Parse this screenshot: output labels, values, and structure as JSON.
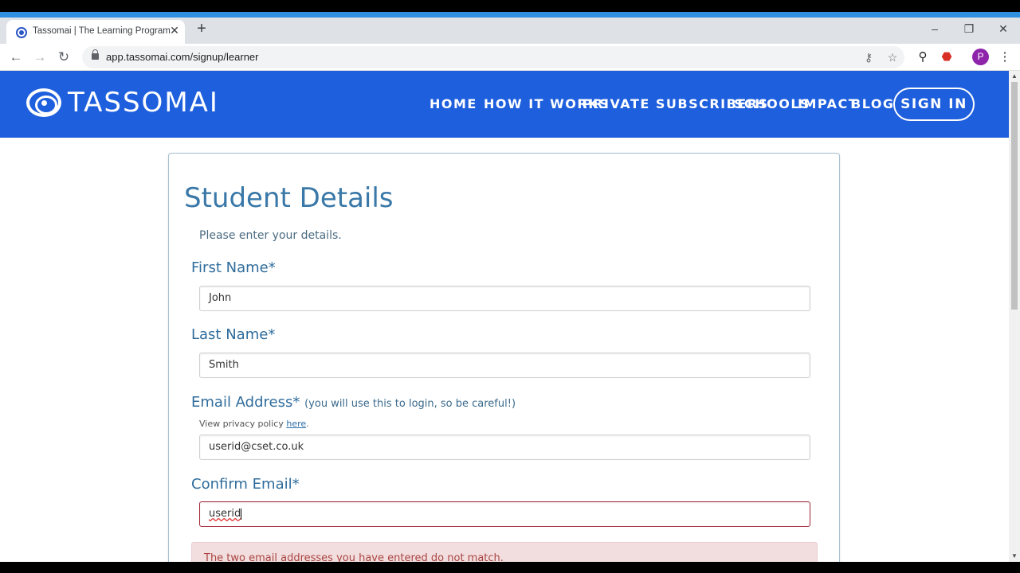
{
  "browser": {
    "tab_title": "Tassomai | The Learning Program",
    "tab_close": "✕",
    "new_tab": "+",
    "url": "app.tassomai.com/signup/learner",
    "profile_initial": "P",
    "window_controls": {
      "minimize": "–",
      "restore": "❐",
      "close": "✕"
    }
  },
  "site": {
    "brand": "TASSOMAI",
    "nav": [
      "HOME",
      "HOW IT WORKS",
      "PRIVATE SUBSCRIBERS",
      "SCHOOLS",
      "IMPACT",
      "BLOG"
    ],
    "sign_in": "SIGN IN",
    "brand_color": "#1e5fdd"
  },
  "form": {
    "title": "Student Details",
    "intro": "Please enter your details.",
    "first_name": {
      "label": "First Name*",
      "value": "John"
    },
    "last_name": {
      "label": "Last Name*",
      "value": "Smith"
    },
    "email": {
      "label": "Email Address*",
      "note": "(you will use this to login, so be careful!)",
      "privacy_prefix": "View privacy policy ",
      "privacy_link": "here",
      "privacy_suffix": ".",
      "value": "userid@cset.co.uk"
    },
    "confirm_email": {
      "label": "Confirm Email*",
      "value": "userid"
    },
    "error_message": "The two email addresses you have entered do not match."
  }
}
